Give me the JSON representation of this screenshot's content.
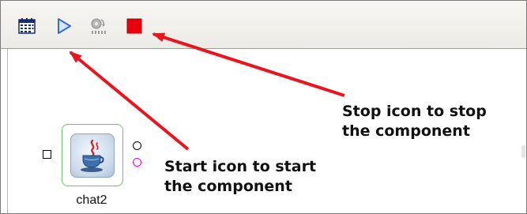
{
  "toolbar": {
    "buttons": [
      {
        "icon": "calendar-grid-icon"
      },
      {
        "icon": "start-play-icon",
        "color": "#2f6fd6"
      },
      {
        "icon": "pause-gear-icon",
        "color": "#9a9a9a"
      },
      {
        "icon": "stop-square-icon",
        "color": "#e8000b"
      }
    ]
  },
  "component": {
    "label": "chat2",
    "icon": "java-cup-icon",
    "border_color": "#6fc06f"
  },
  "callouts": {
    "stop_line1": "Stop icon to stop",
    "stop_line2": "the component",
    "start_line1": "Start icon to start",
    "start_line2": "the component"
  },
  "colors": {
    "arrow": "#e8151f"
  }
}
